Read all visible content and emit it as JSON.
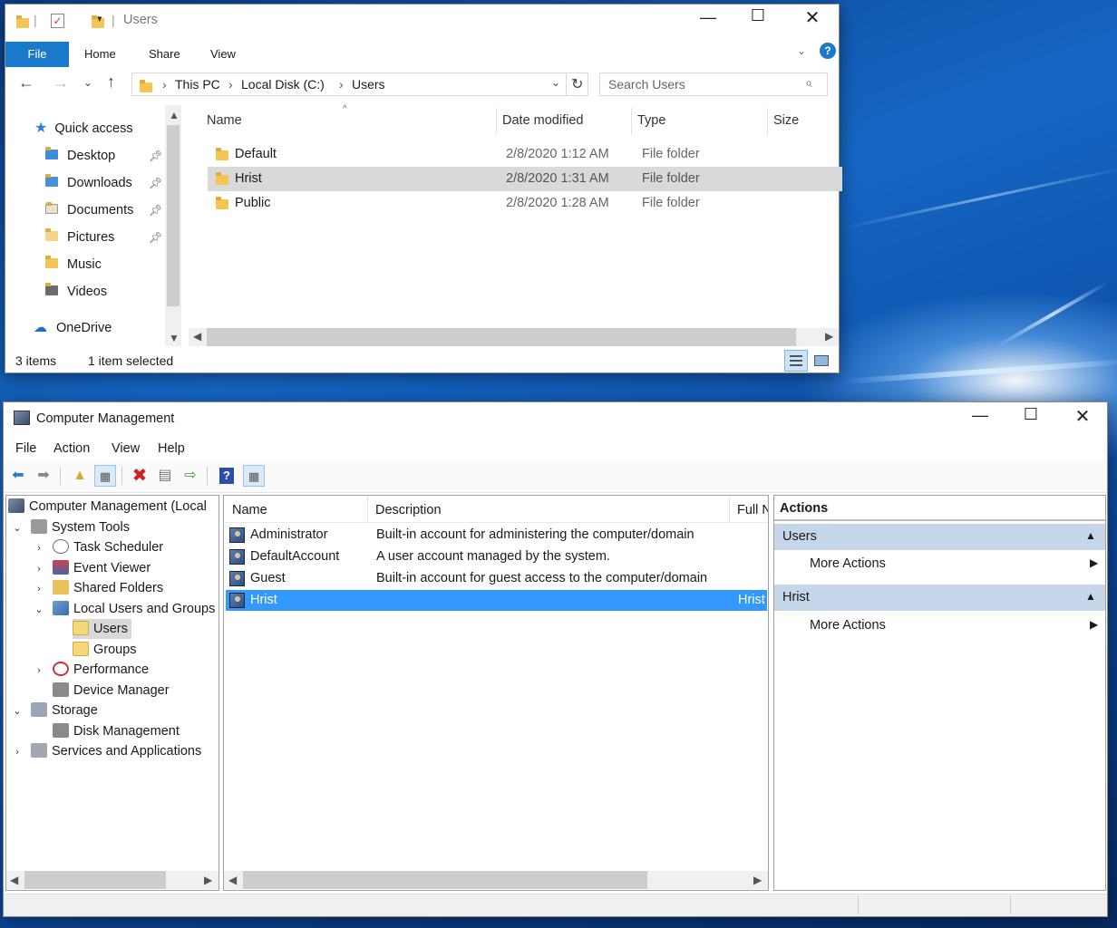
{
  "explorer": {
    "title": "Users",
    "ribbon_tabs": [
      "File",
      "Home",
      "Share",
      "View"
    ],
    "help_glyph": "?",
    "breadcrumb": [
      "This PC",
      "Local Disk (C:)",
      "Users"
    ],
    "search_placeholder": "Search Users",
    "nav": [
      {
        "label": "Quick access",
        "icon": "star-icon",
        "pinned": false
      },
      {
        "label": "Desktop",
        "icon": "desktop-folder-icon",
        "pinned": true
      },
      {
        "label": "Downloads",
        "icon": "downloads-folder-icon",
        "pinned": true
      },
      {
        "label": "Documents",
        "icon": "documents-folder-icon",
        "pinned": true
      },
      {
        "label": "Pictures",
        "icon": "pictures-folder-icon",
        "pinned": true
      },
      {
        "label": "Music",
        "icon": "music-folder-icon",
        "pinned": false
      },
      {
        "label": "Videos",
        "icon": "videos-folder-icon",
        "pinned": false
      },
      {
        "label": "OneDrive",
        "icon": "onedrive-icon",
        "pinned": false
      }
    ],
    "columns": [
      "Name",
      "Date modified",
      "Type",
      "Size"
    ],
    "rows": [
      {
        "name": "Default",
        "date": "2/8/2020 1:12 AM",
        "type": "File folder",
        "selected": false
      },
      {
        "name": "Hrist",
        "date": "2/8/2020 1:31 AM",
        "type": "File folder",
        "selected": true
      },
      {
        "name": "Public",
        "date": "2/8/2020 1:28 AM",
        "type": "File folder",
        "selected": false
      }
    ],
    "status": {
      "items": "3 items",
      "selected": "1 item selected"
    }
  },
  "compmgmt": {
    "title": "Computer Management",
    "menu": [
      "File",
      "Action",
      "View",
      "Help"
    ],
    "tree": [
      {
        "label": "Computer Management (Local",
        "twisty": "",
        "icon": "computer-management-icon",
        "selected": false
      },
      {
        "label": "System Tools",
        "twisty": "⌄",
        "icon": "system-tools-icon",
        "selected": false
      },
      {
        "label": "Task Scheduler",
        "twisty": "›",
        "icon": "task-scheduler-icon",
        "selected": false
      },
      {
        "label": "Event Viewer",
        "twisty": "›",
        "icon": "event-viewer-icon",
        "selected": false
      },
      {
        "label": "Shared Folders",
        "twisty": "›",
        "icon": "shared-folders-icon",
        "selected": false
      },
      {
        "label": "Local Users and Groups",
        "twisty": "⌄",
        "icon": "local-users-groups-icon",
        "selected": false
      },
      {
        "label": "Users",
        "twisty": "",
        "icon": "users-folder-icon",
        "selected": true
      },
      {
        "label": "Groups",
        "twisty": "",
        "icon": "groups-folder-icon",
        "selected": false
      },
      {
        "label": "Performance",
        "twisty": "›",
        "icon": "performance-icon",
        "selected": false
      },
      {
        "label": "Device Manager",
        "twisty": "",
        "icon": "device-manager-icon",
        "selected": false
      },
      {
        "label": "Storage",
        "twisty": "⌄",
        "icon": "storage-icon",
        "selected": false
      },
      {
        "label": "Disk Management",
        "twisty": "",
        "icon": "disk-management-icon",
        "selected": false
      },
      {
        "label": "Services and Applications",
        "twisty": "›",
        "icon": "services-applications-icon",
        "selected": false
      }
    ],
    "list_columns": [
      "Name",
      "Description",
      "Full N"
    ],
    "users": [
      {
        "name": "Administrator",
        "description": "Built-in account for administering the computer/domain",
        "full": "",
        "selected": false
      },
      {
        "name": "DefaultAccount",
        "description": "A user account managed by the system.",
        "full": "",
        "selected": false
      },
      {
        "name": "Guest",
        "description": "Built-in account for guest access to the computer/domain",
        "full": "",
        "selected": false
      },
      {
        "name": "Hrist",
        "description": "",
        "full": "Hrist",
        "selected": true
      }
    ],
    "actions": {
      "header": "Actions",
      "sections": [
        {
          "title": "Users",
          "item": "More Actions"
        },
        {
          "title": "Hrist",
          "item": "More Actions"
        }
      ]
    }
  },
  "colors": {
    "accent": "#1979ca",
    "selection": "#3399ff",
    "action_header": "#c5d6ea"
  }
}
